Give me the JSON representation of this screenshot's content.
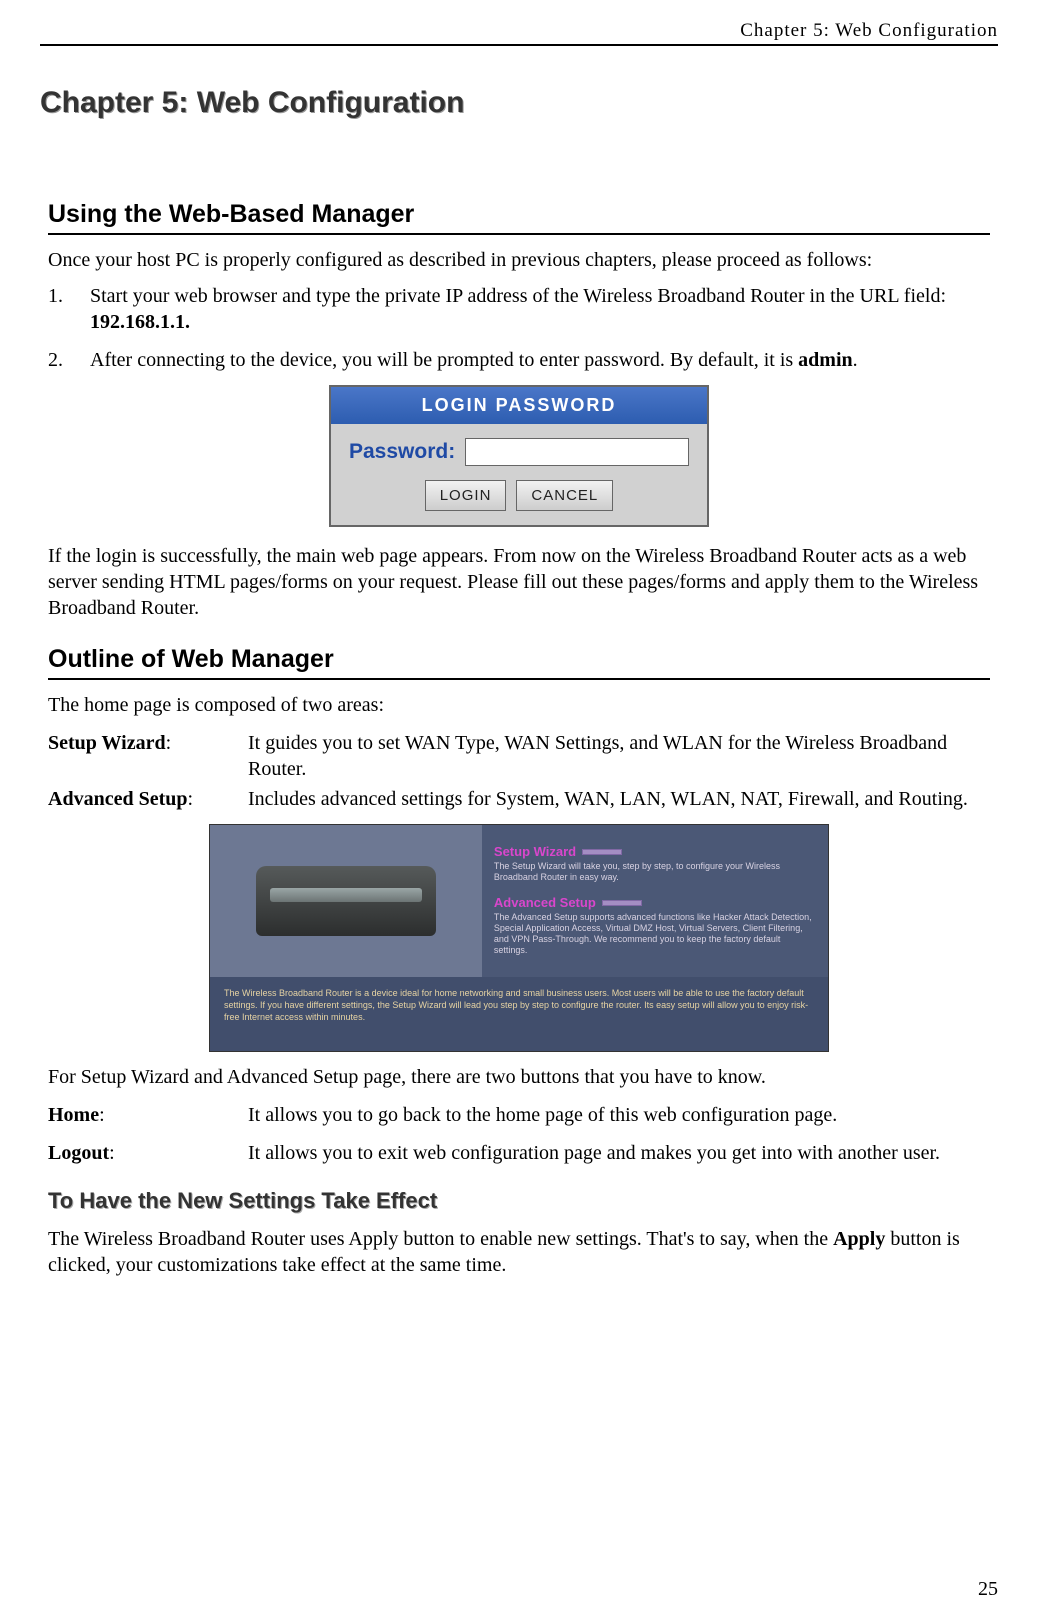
{
  "header": {
    "running_head": "Chapter 5: Web Configuration"
  },
  "chapter_title": "Chapter 5: Web Configuration",
  "section1": {
    "title": "Using the Web-Based Manager",
    "intro": "Once your host PC is properly configured as described in previous chapters, please proceed as follows:",
    "step1_a": "Start your web browser and type the private IP address of the Wireless Broadband Router in the URL field: ",
    "step1_b": "192.168.1.1.",
    "step2_a": "After connecting to the device, you will be prompted to enter password. By default, it is ",
    "step2_b": "admin",
    "step2_c": ".",
    "after_login": "If the login is successfully, the main web page appears. From now on the Wireless Broadband Router acts as a web server sending HTML pages/forms on your request. Please fill out these pages/forms and apply them to the Wireless Broadband Router."
  },
  "login_box": {
    "header": "LOGIN PASSWORD",
    "label": "Password:",
    "login_btn": "LOGIN",
    "cancel_btn": "CANCEL"
  },
  "section2": {
    "title": "Outline of Web Manager",
    "intro": "The home page is composed of two areas:",
    "setup_wizard_term": "Setup Wizard",
    "setup_wizard_desc": "It guides you to set WAN Type, WAN Settings, and WLAN for the Wireless Broadband Router.",
    "advanced_setup_term": "Advanced Setup",
    "advanced_setup_desc": "Includes advanced settings for System, WAN, LAN, WLAN, NAT, Firewall, and Routing.",
    "after_image": "For Setup Wizard and Advanced Setup page, there are two buttons that you have to know.",
    "home_term": "Home",
    "home_desc": "It allows you to go back to the home page of this web configuration page.",
    "logout_term": "Logout",
    "logout_desc": "It allows you to exit web configuration page and makes you get into with another user."
  },
  "router_image": {
    "wiz_title": "Setup Wizard",
    "wiz_text": "The Setup Wizard will take you, step by step, to configure your Wireless Broadband Router in easy way.",
    "adv_title": "Advanced Setup",
    "adv_text": "The Advanced Setup supports advanced functions like Hacker Attack Detection, Special Application Access, Virtual DMZ Host, Virtual Servers, Client Filtering, and VPN Pass-Through. We recommend you to keep the factory default settings.",
    "footer": "The Wireless Broadband Router is a device ideal for home networking and small business users. Most users will be able to use the factory default settings. If you have different settings, the Setup Wizard will lead you step by step to configure the router. Its easy setup will allow you to enjoy risk-free Internet access within minutes."
  },
  "section3": {
    "title": "To Have the New Settings Take Effect",
    "body_a": "The Wireless Broadband Router uses Apply button to enable new settings. That's to say, when the ",
    "body_b": "Apply",
    "body_c": " button is clicked, your customizations take effect at the same time."
  },
  "page_number": "25"
}
